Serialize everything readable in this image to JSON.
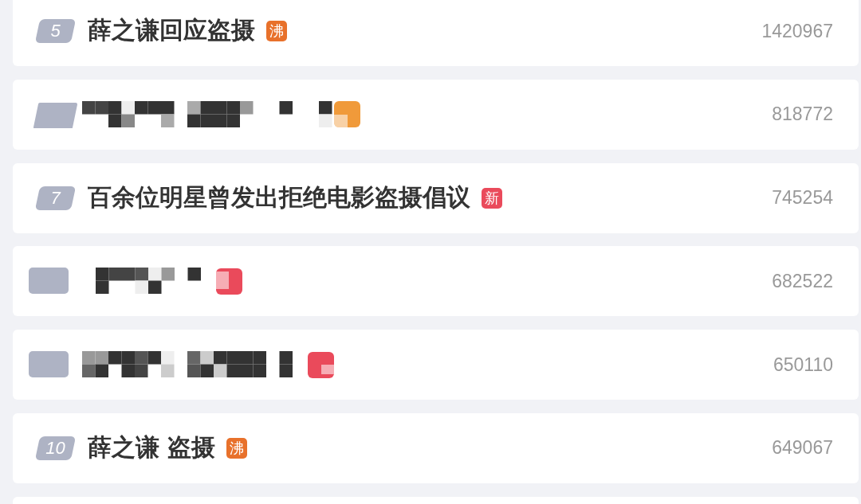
{
  "items": [
    {
      "kind": "topic",
      "rank": "5",
      "title": "薛之谦回应盗摄",
      "tag": {
        "label": "沸",
        "color": "#e8712b"
      },
      "count": "1420967"
    },
    {
      "kind": "redacted",
      "tag": {
        "color": "#f09a3a"
      },
      "count": "818772"
    },
    {
      "kind": "topic",
      "rank": "7",
      "title": "百余位明星曾发出拒绝电影盗摄倡议",
      "tag": {
        "label": "新",
        "color": "#ea4a5b"
      },
      "count": "745254"
    },
    {
      "kind": "redacted",
      "tag": {
        "color": "#ea4a5b"
      },
      "count": "682522"
    },
    {
      "kind": "redacted",
      "tag": {
        "color": "#ea4a5b"
      },
      "count": "650110"
    },
    {
      "kind": "topic",
      "rank": "10",
      "title": "薛之谦 盗摄",
      "tag": {
        "label": "沸",
        "color": "#e8712b"
      },
      "count": "649067"
    }
  ]
}
